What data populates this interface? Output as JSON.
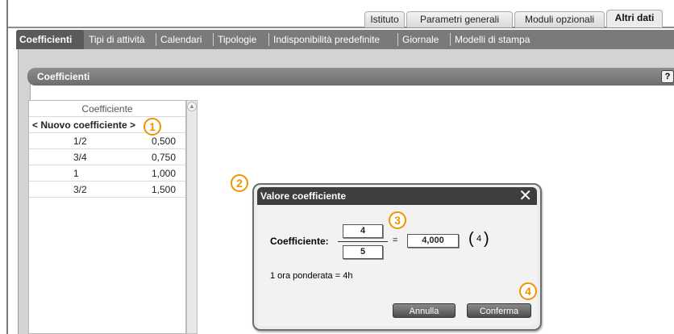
{
  "top_tabs": [
    "Istituto",
    "Parametri generali",
    "Moduli opzionali",
    "Altri dati"
  ],
  "sub_tabs": [
    "Coefficienti",
    "Tipi di attività",
    "Calendari",
    "Tipologie",
    "Indisponibilità predefinite",
    "Giornale",
    "Modelli di stampa"
  ],
  "section_title": "Coefficienti",
  "help_icon": "?",
  "table": {
    "header": "Coefficiente",
    "new_row": "< Nuovo coefficiente >",
    "rows": [
      {
        "fraction": "1/2",
        "value": "0,500"
      },
      {
        "fraction": "3/4",
        "value": "0,750"
      },
      {
        "fraction": "1",
        "value": "1,000"
      },
      {
        "fraction": "3/2",
        "value": "1,500"
      }
    ]
  },
  "markers": [
    "1",
    "2",
    "3",
    "4"
  ],
  "dialog": {
    "title": "Valore coefficiente",
    "close": "X",
    "label": "Coefficiente:",
    "numerator": "4",
    "denominator": "5",
    "equals": "=",
    "result": "4,000",
    "paren_value": "4",
    "note": "1 ora ponderata = 4h",
    "cancel_label": "Annulla",
    "confirm_label": "Conferma"
  },
  "colors": {
    "marker": "#f29400",
    "tab_bar": "#7a7a7a",
    "dialog_title": "#3e3e3e"
  }
}
